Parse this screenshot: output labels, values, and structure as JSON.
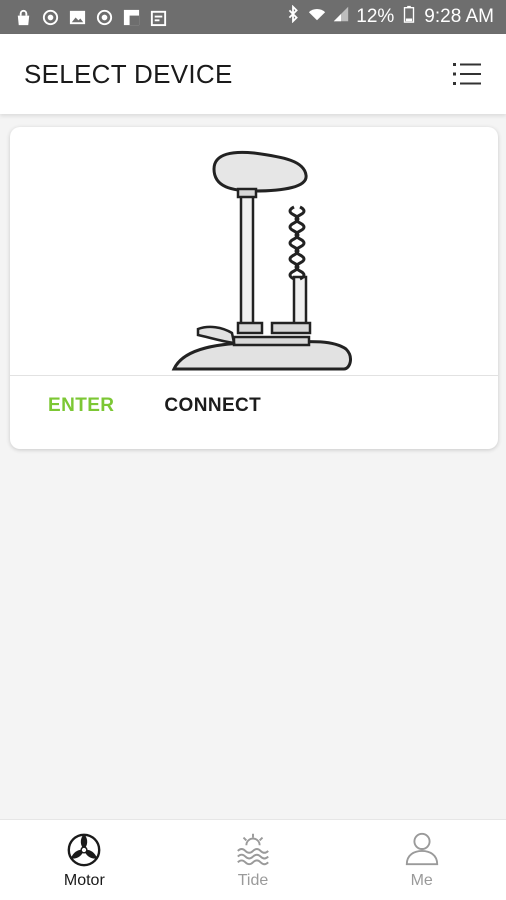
{
  "status_bar": {
    "battery": "12%",
    "time": "9:28 AM",
    "left_icons": [
      "bag-icon",
      "sync-icon",
      "image-icon",
      "sync-alt-icon",
      "flipboard-icon",
      "calendar-icon"
    ],
    "right_icons": [
      "bluetooth-icon",
      "wifi-icon",
      "signal-icon",
      "battery-icon"
    ]
  },
  "app_bar": {
    "title": "SELECT DEVICE",
    "menu_icon": "list-icon"
  },
  "device_card": {
    "image": "trolling-motor-image",
    "enter_label": "ENTER",
    "connect_label": "CONNECT"
  },
  "bottom_nav": {
    "items": [
      {
        "label": "Motor",
        "icon": "propeller-icon",
        "active": true
      },
      {
        "label": "Tide",
        "icon": "tide-icon",
        "active": false
      },
      {
        "label": "Me",
        "icon": "person-icon",
        "active": false
      }
    ]
  },
  "colors": {
    "accent_green": "#7cc734",
    "status_bar": "#6e6e6e",
    "background": "#f4f4f4"
  }
}
